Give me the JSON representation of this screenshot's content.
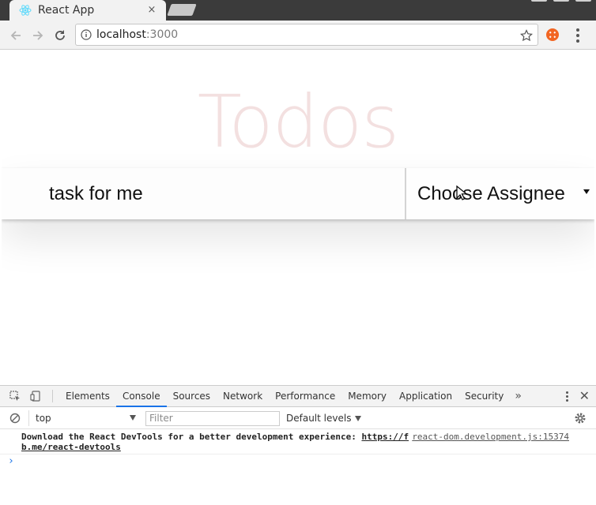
{
  "browser": {
    "tab_title": "React App",
    "tab_close": "×",
    "url_host": "localhost",
    "url_port": ":3000"
  },
  "page": {
    "title": "Todos",
    "todo_input_value": "task for me",
    "assignee_select_label": "Choose Assignee",
    "colors": {
      "title": "#af2f2f",
      "text": "#111111"
    }
  },
  "devtools": {
    "tabs": [
      "Elements",
      "Console",
      "Sources",
      "Network",
      "Performance",
      "Memory",
      "Application",
      "Security"
    ],
    "active_tab": "Console",
    "more": "»",
    "close": "✕",
    "context": "top",
    "filter_placeholder": "Filter",
    "levels": "Default levels",
    "message_text": "Download the React DevTools for a better development experience: ",
    "message_link_part1": "https://f",
    "message_link_part2": "b.me/react-devtools",
    "message_source": "react-dom.development.js:15374",
    "prompt": "›",
    "accent": "#1a73e8"
  }
}
